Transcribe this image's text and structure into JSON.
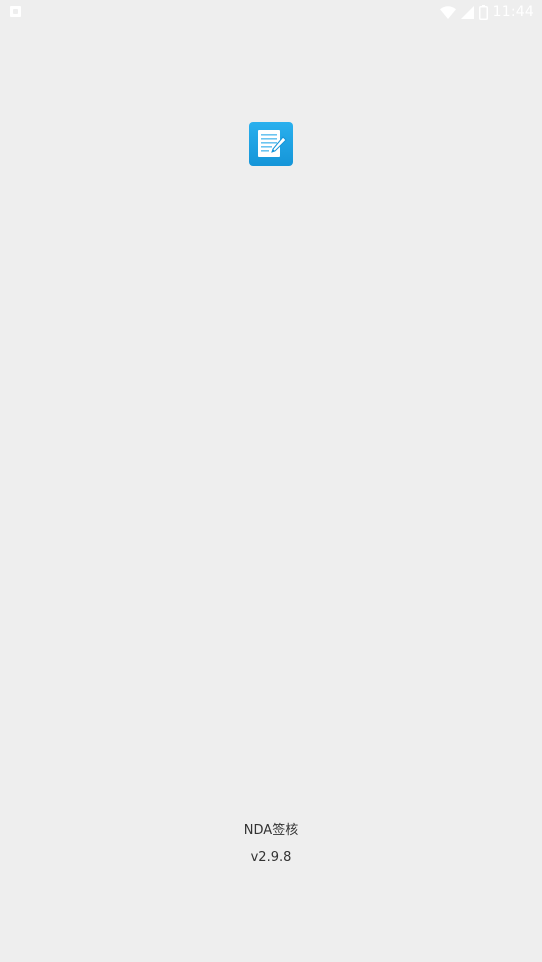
{
  "status_bar": {
    "time": "11:44",
    "icons": [
      "notification-icon",
      "wifi-icon",
      "cell-signal-icon",
      "battery-icon"
    ]
  },
  "splash": {
    "app_icon": "notepad-pen-icon",
    "app_name": "NDA签核",
    "version": "v2.9.8"
  },
  "colors": {
    "background": "#eeeeee",
    "icon_blue": "#1aa3e8",
    "text": "#333333"
  }
}
